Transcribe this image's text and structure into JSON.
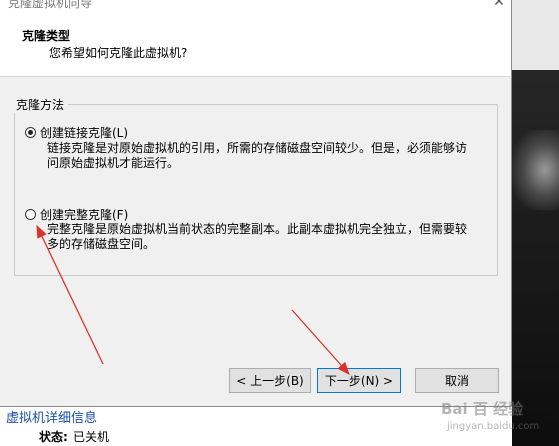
{
  "window": {
    "title": "克隆虚拟机向导",
    "close_glyph": "✕"
  },
  "header": {
    "title": "克隆类型",
    "subtitle": "您希望如何克隆此虚拟机?"
  },
  "clone_method": {
    "legend": "克隆方法",
    "options": [
      {
        "label": "创建链接克隆(L)",
        "selected": true,
        "description": "链接克隆是对原始虚拟机的引用，所需的存储磁盘空间较少。但是，必须能够访问原始虚拟机才能运行。"
      },
      {
        "label": "创建完整克隆(F)",
        "selected": false,
        "description": "完整克隆是原始虚拟机当前状态的完整副本。此副本虚拟机完全独立，但需要较多的存储磁盘空间。"
      }
    ]
  },
  "buttons": {
    "back": "< 上一步(B)",
    "next": "下一步(N) >",
    "cancel": "取消"
  },
  "background": {
    "details_link": "虚拟机详细信息",
    "status_label": "状态:",
    "status_value": "已关机"
  },
  "watermark": {
    "text": "Bai 百 经验",
    "sub": "jingyan.baidu.com"
  },
  "colors": {
    "annotation_arrow": "#d9342b",
    "dialog_bg": "#f0f0f0",
    "focus_border": "#0078d7"
  }
}
